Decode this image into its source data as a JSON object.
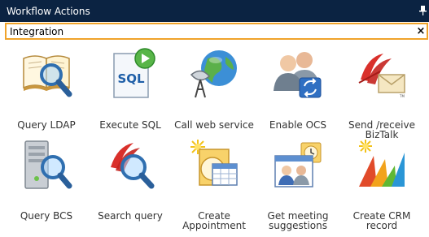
{
  "window": {
    "title": "Workflow Actions"
  },
  "search": {
    "value": "Integration",
    "clear_glyph": "×"
  },
  "actions": [
    {
      "label": "Query LDAP",
      "icon": "book-magnifier-icon"
    },
    {
      "label": "Execute SQL",
      "icon": "sql-document-icon"
    },
    {
      "label": "Call web service",
      "icon": "globe-satellite-icon"
    },
    {
      "label": "Enable OCS",
      "icon": "users-sync-icon"
    },
    {
      "label": "Send /receive BizTalk",
      "icon": "biztalk-envelope-icon"
    },
    {
      "label": "Query BCS",
      "icon": "server-magnifier-icon"
    },
    {
      "label": "Search query",
      "icon": "search-magnifier-icon"
    },
    {
      "label": "Create Appointment",
      "icon": "calendar-clock-icon"
    },
    {
      "label": "Get meeting suggestions",
      "icon": "meeting-suggestions-icon"
    },
    {
      "label": "Create CRM record",
      "icon": "crm-record-icon"
    }
  ],
  "colors": {
    "title_bar": "#0b2342",
    "search_border": "#f0a32a"
  }
}
